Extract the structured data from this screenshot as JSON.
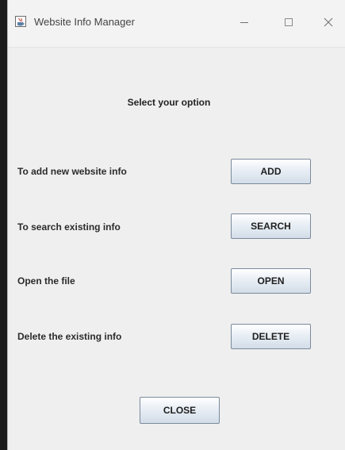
{
  "window": {
    "title": "Website Info Manager",
    "controls": {
      "minimize_icon": "minimize-icon",
      "maximize_icon": "maximize-icon",
      "close_icon": "close-icon"
    }
  },
  "main": {
    "heading": "Select your option",
    "options": [
      {
        "label": "To add new website info",
        "button": "ADD"
      },
      {
        "label": "To search existing info",
        "button": "SEARCH"
      },
      {
        "label": "Open the file",
        "button": "OPEN"
      },
      {
        "label": "Delete the existing info",
        "button": "DELETE"
      }
    ],
    "close_button": "CLOSE"
  },
  "colors": {
    "window_background": "#efefef",
    "titlebar_background": "#f3f3f3",
    "button_border": "#7a8a9c",
    "button_gradient_top": "#ffffff",
    "button_gradient_bottom": "#d3dde8"
  }
}
